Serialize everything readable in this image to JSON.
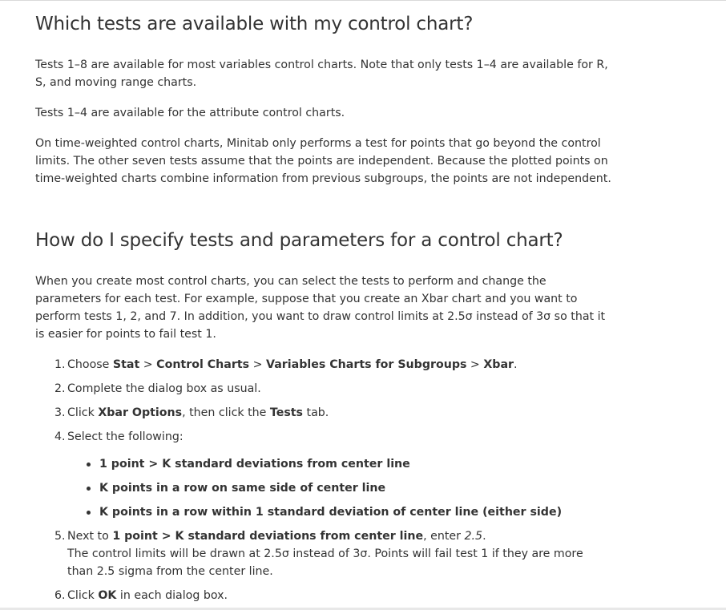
{
  "section1": {
    "title": "Which tests are available with my control chart?",
    "p1": "Tests 1–8 are available for most variables control charts. Note that only tests 1–4 are available for R, S, and moving range charts.",
    "p2": "Tests 1–4 are available for the attribute control charts.",
    "p3": "On time-weighted control charts, Minitab only performs a test for points that go beyond the control limits. The other seven tests assume that the points are independent. Because the plotted points on time-weighted charts combine information from previous subgroups, the points are not independent."
  },
  "section2": {
    "title": "How do I specify tests and parameters for a control chart?",
    "intro": "When you create most control charts, you can select the tests to perform and change the parameters for each test. For example, suppose that you create an Xbar chart and you want to perform tests 1, 2, and 7. In addition, you want to draw control limits at 2.5σ instead of 3σ so that it is easier for points to fail test 1.",
    "steps": {
      "s1": {
        "num": "1.",
        "pre": "Choose ",
        "b1": "Stat",
        "sep1": " > ",
        "b2": "Control Charts",
        "sep2": " > ",
        "b3": "Variables Charts for Subgroups",
        "sep3": " > ",
        "b4": "Xbar",
        "post": "."
      },
      "s2": {
        "num": "2.",
        "text": "Complete the dialog box as usual."
      },
      "s3": {
        "num": "3.",
        "pre": "Click ",
        "b1": "Xbar Options",
        "mid": ", then click the ",
        "b2": "Tests",
        "post": " tab."
      },
      "s4": {
        "num": "4.",
        "text": "Select the following:",
        "options": [
          "1 point > K standard deviations from center line",
          "K points in a row on same side of center line",
          "K points in a row within 1 standard deviation of center line (either side)"
        ]
      },
      "s5": {
        "num": "5.",
        "pre": "Next to ",
        "b1": "1 point > K standard deviations from center line",
        "mid": ", enter ",
        "value": "2.5",
        "post": ".",
        "note": "The control limits will be drawn at 2.5σ instead of 3σ. Points will fail test 1 if they are more than 2.5 sigma from the center line."
      },
      "s6": {
        "num": "6.",
        "pre": "Click ",
        "b1": "OK",
        "post": " in each dialog box."
      }
    }
  }
}
